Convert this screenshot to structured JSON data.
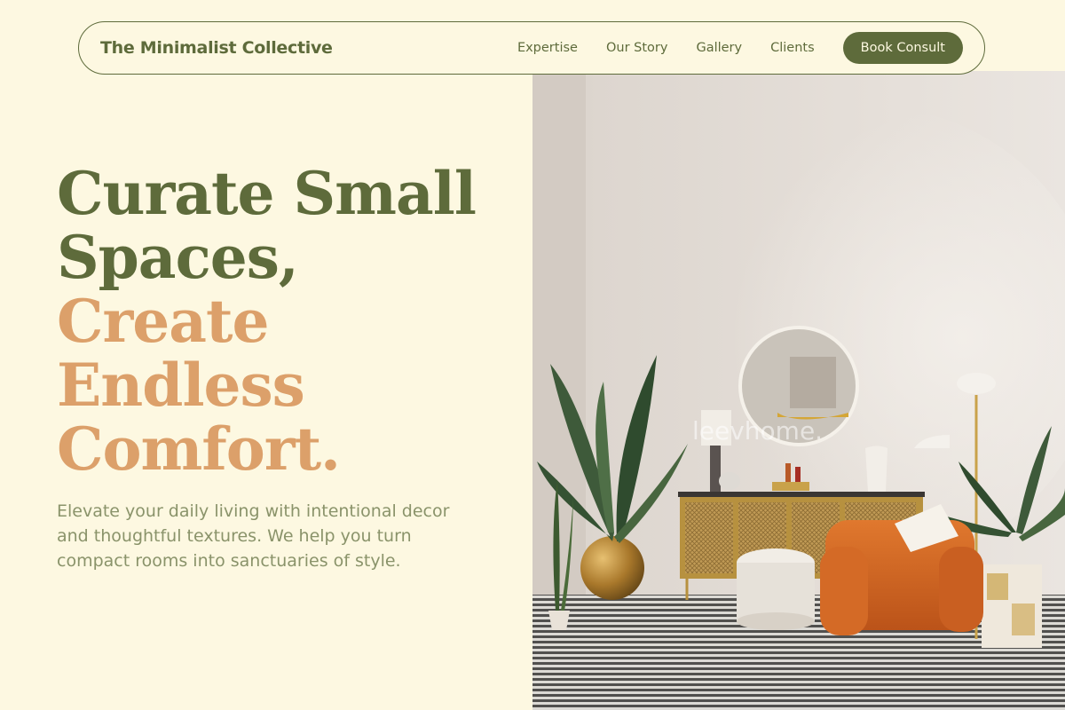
{
  "nav": {
    "brand": "The Minimalist Collective",
    "links": [
      "Expertise",
      "Our Story",
      "Gallery",
      "Clients"
    ],
    "cta": "Book Consult"
  },
  "hero": {
    "headline_lines_dark": [
      "Curate Small",
      "Spaces,"
    ],
    "headline_lines_accent": [
      "Create",
      "Endless",
      "Comfort."
    ],
    "subtitle": "Elevate your daily living with intentional decor and thoughtful textures. We help you turn compact rooms into sanctuaries of style.",
    "image_watermark": "leevhome."
  },
  "colors": {
    "background": "#fdf8e1",
    "olive": "#5e6b3b",
    "accent": "#dca06a",
    "muted_text": "#8a936a"
  }
}
